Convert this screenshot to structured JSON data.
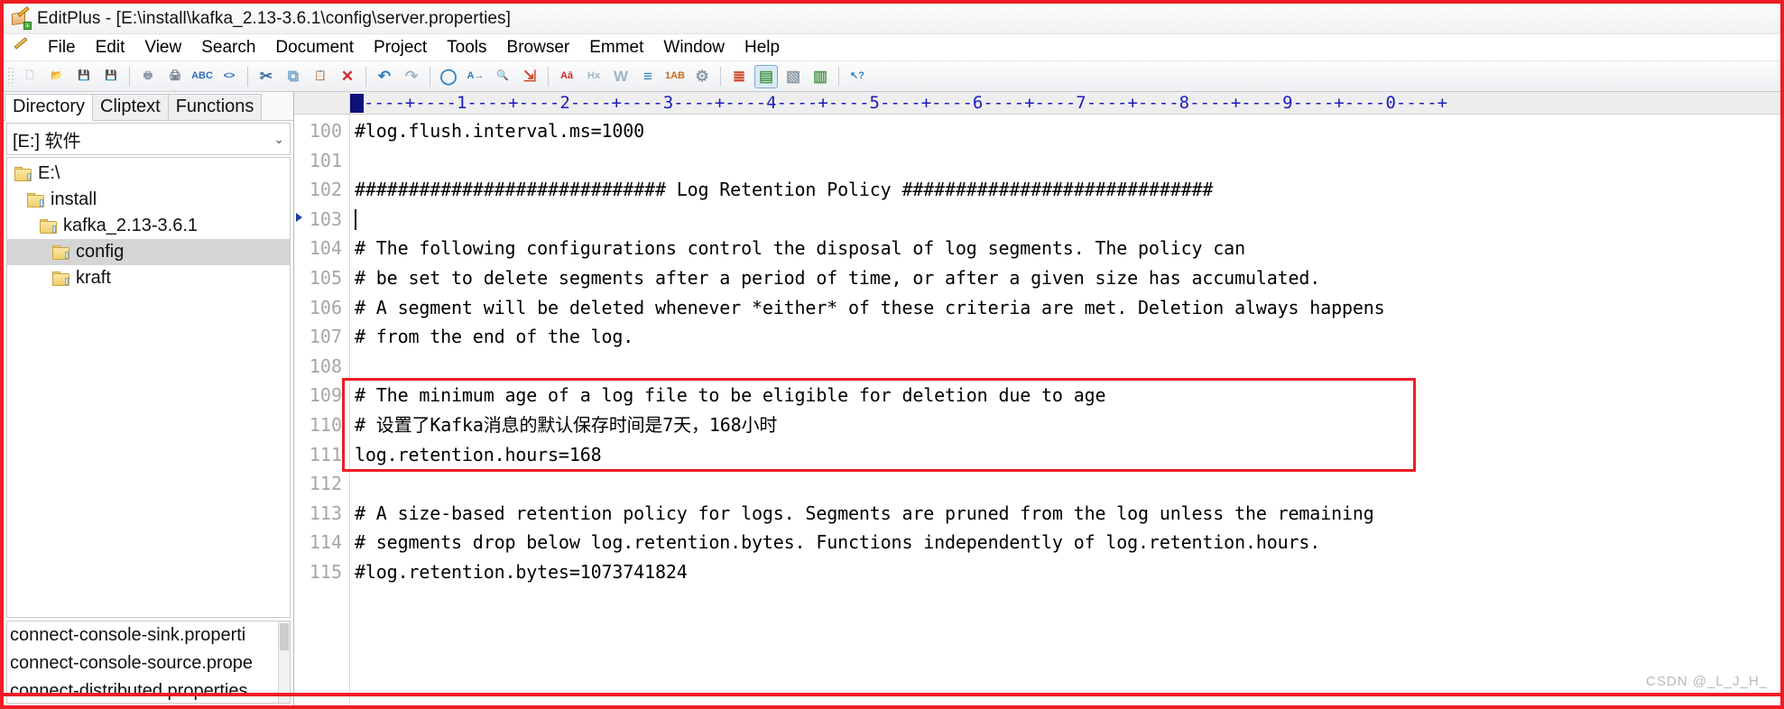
{
  "window": {
    "app_name": "EditPlus",
    "title": "EditPlus - [E:\\install\\kafka_2.13-3.6.1\\config\\server.properties]",
    "icon": "editplus-icon"
  },
  "menubar": {
    "items": [
      {
        "label": "File",
        "accel": "F"
      },
      {
        "label": "Edit",
        "accel": "E"
      },
      {
        "label": "View",
        "accel": "V"
      },
      {
        "label": "Search",
        "accel": "S"
      },
      {
        "label": "Document",
        "accel": "D"
      },
      {
        "label": "Project",
        "accel": "P"
      },
      {
        "label": "Tools",
        "accel": "T"
      },
      {
        "label": "Browser",
        "accel": "B"
      },
      {
        "label": "Emmet",
        "accel": "m"
      },
      {
        "label": "Window",
        "accel": "W"
      },
      {
        "label": "Help",
        "accel": "H"
      }
    ]
  },
  "toolbar": {
    "buttons": [
      {
        "name": "new-file-icon",
        "glyph": "🗋",
        "color": "#c9cfd6"
      },
      {
        "name": "open-file-icon",
        "glyph": "📂",
        "color": "#e8b84b"
      },
      {
        "name": "save-icon",
        "glyph": "💾",
        "color": "#4f9b4f"
      },
      {
        "name": "save-all-icon",
        "glyph": "💾",
        "color": "#3f8f3f"
      },
      {
        "name": "separator",
        "glyph": "",
        "color": ""
      },
      {
        "name": "print-preview-icon",
        "glyph": "🖶",
        "color": "#8d9aa6"
      },
      {
        "name": "print-icon",
        "glyph": "🖨",
        "color": "#6b7580"
      },
      {
        "name": "spell-check-icon",
        "glyph": "ABC",
        "color": "#2f6fb5"
      },
      {
        "name": "view-in-browser-icon",
        "glyph": "<>",
        "color": "#2f6fb5"
      },
      {
        "name": "separator",
        "glyph": "",
        "color": ""
      },
      {
        "name": "cut-icon",
        "glyph": "✂",
        "color": "#3a6ea5"
      },
      {
        "name": "copy-icon",
        "glyph": "⧉",
        "color": "#7aa7cc"
      },
      {
        "name": "paste-icon",
        "glyph": "📋",
        "color": "#b4753a"
      },
      {
        "name": "delete-icon",
        "glyph": "✕",
        "color": "#cc2b2b"
      },
      {
        "name": "separator",
        "glyph": "",
        "color": ""
      },
      {
        "name": "undo-icon",
        "glyph": "↶",
        "color": "#2f7fc1"
      },
      {
        "name": "redo-icon",
        "glyph": "↷",
        "color": "#9fb6c6"
      },
      {
        "name": "separator",
        "glyph": "",
        "color": ""
      },
      {
        "name": "find-icon",
        "glyph": "◯",
        "color": "#2f7fc1"
      },
      {
        "name": "replace-icon",
        "glyph": "A→",
        "color": "#2f7fc1"
      },
      {
        "name": "find-in-files-icon",
        "glyph": "🔍",
        "color": "#6b8ea8"
      },
      {
        "name": "goto-line-icon",
        "glyph": "⇲",
        "color": "#cc4b2b"
      },
      {
        "name": "separator",
        "glyph": "",
        "color": ""
      },
      {
        "name": "font-icon",
        "glyph": "Aā",
        "color": "#cc2b2b"
      },
      {
        "name": "hex-view-icon",
        "glyph": "Hx",
        "color": "#9fb6c6"
      },
      {
        "name": "word-wrap-icon",
        "glyph": "W",
        "color": "#9fb6c6"
      },
      {
        "name": "indent-icon",
        "glyph": "≡",
        "color": "#2f7fc1"
      },
      {
        "name": "line-numbers-icon",
        "glyph": "1AB",
        "color": "#cc6a1e"
      },
      {
        "name": "preferences-icon",
        "glyph": "⚙",
        "color": "#8d9aa6"
      },
      {
        "name": "separator",
        "glyph": "",
        "color": ""
      },
      {
        "name": "document-selector-icon",
        "glyph": "≣",
        "color": "#cc4b2b"
      },
      {
        "name": "directory-window-icon",
        "glyph": "▤",
        "color": "#4f9b4f"
      },
      {
        "name": "cliptext-window-icon",
        "glyph": "▧",
        "color": "#8d9aa6"
      },
      {
        "name": "function-list-icon",
        "glyph": "▥",
        "color": "#4f9b4f"
      },
      {
        "name": "separator",
        "glyph": "",
        "color": ""
      },
      {
        "name": "help-pointer-icon",
        "glyph": "↖?",
        "color": "#2f7fc1"
      }
    ],
    "active_button": "directory-window-icon"
  },
  "sidebar": {
    "tabs": [
      {
        "label": "Directory",
        "selected": true
      },
      {
        "label": "Cliptext",
        "selected": false
      },
      {
        "label": "Functions",
        "selected": false
      }
    ],
    "drive_combo": {
      "value": "[E:] 软件",
      "chevron": "⌄"
    },
    "tree": [
      {
        "label": "E:\\",
        "depth": 0,
        "selected": false
      },
      {
        "label": "install",
        "depth": 1,
        "selected": false
      },
      {
        "label": "kafka_2.13-3.6.1",
        "depth": 2,
        "selected": false
      },
      {
        "label": "config",
        "depth": 3,
        "selected": true
      },
      {
        "label": "kraft",
        "depth": 3,
        "selected": false
      }
    ],
    "files": [
      {
        "name": "connect-console-sink.properti"
      },
      {
        "name": "connect-console-source.prope"
      },
      {
        "name": "connect-distributed.properties"
      }
    ]
  },
  "editor": {
    "ruler": "----+----1----+----2----+----3----+----4----+----5----+----6----+----7----+----8----+----9----+----0----+",
    "caret_line": 103,
    "lines": [
      {
        "num": "100",
        "text": "#log.flush.interval.ms=1000"
      },
      {
        "num": "101",
        "text": ""
      },
      {
        "num": "102",
        "text": "############################# Log Retention Policy #############################"
      },
      {
        "num": "103",
        "text": "",
        "caret": true,
        "marker": true
      },
      {
        "num": "104",
        "text": "# The following configurations control the disposal of log segments. The policy can"
      },
      {
        "num": "105",
        "text": "# be set to delete segments after a period of time, or after a given size has accumulated."
      },
      {
        "num": "106",
        "text": "# A segment will be deleted whenever *either* of these criteria are met. Deletion always happens"
      },
      {
        "num": "107",
        "text": "# from the end of the log."
      },
      {
        "num": "108",
        "text": ""
      },
      {
        "num": "109",
        "text": "# The minimum age of a log file to be eligible for deletion due to age"
      },
      {
        "num": "110",
        "text": "# 设置了Kafka消息的默认保存时间是7天，168小时"
      },
      {
        "num": "111",
        "text": "log.retention.hours=168"
      },
      {
        "num": "112",
        "text": ""
      },
      {
        "num": "113",
        "text": "# A size-based retention policy for logs. Segments are pruned from the log unless the remaining"
      },
      {
        "num": "114",
        "text": "# segments drop below log.retention.bytes. Functions independently of log.retention.hours."
      },
      {
        "num": "115",
        "text": "#log.retention.bytes=1073741824"
      }
    ]
  },
  "annotations": {
    "highlight_color": "#ee1c25",
    "highlight_lines": "109-111",
    "watermark": "CSDN @_L_J_H_"
  }
}
